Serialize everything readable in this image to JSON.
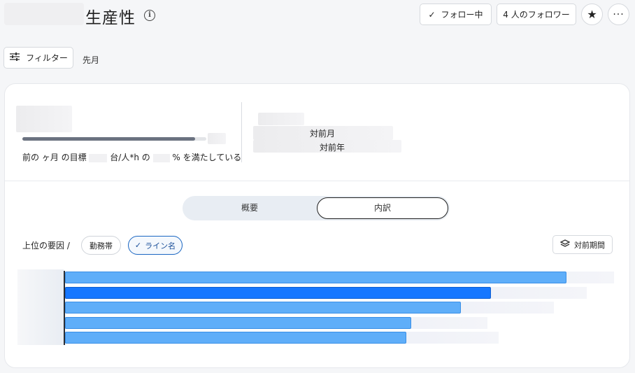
{
  "header": {
    "title": "生産性",
    "follow_label": "フォロー中",
    "followers_label": "4 人のフォロワー"
  },
  "filter": {
    "button_label": "フィルター",
    "period": "先月"
  },
  "kpi": {
    "caption_prefix": "前の ヶ月 の目標",
    "caption_unit": "台/人*h の",
    "caption_suffix": "% を満たしている",
    "progress": 0.94
  },
  "comparison": {
    "vs_prev_month": "対前月",
    "vs_prev_year": "対前年"
  },
  "tabs": {
    "overview": "概要",
    "breakdown": "内訳",
    "active": "breakdown"
  },
  "breakdown": {
    "factor_label": "上位の要因 /",
    "chips": [
      {
        "label": "勤務帯",
        "selected": false
      },
      {
        "label": "ライン名",
        "selected": true
      }
    ],
    "period_compare_label": "対前期間"
  },
  "chart_data": {
    "type": "bar",
    "orientation": "horizontal",
    "categories": [
      "",
      "",
      "",
      "",
      ""
    ],
    "series": [
      {
        "values": [
          100,
          85,
          79,
          69,
          68
        ]
      },
      {
        "values": [
          100,
          95,
          89,
          77,
          79
        ]
      }
    ],
    "highlight_index": 1,
    "colors": {
      "bar": "#5faef9",
      "highlight": "#1677ff",
      "ghost": "#dfe4f3"
    }
  }
}
